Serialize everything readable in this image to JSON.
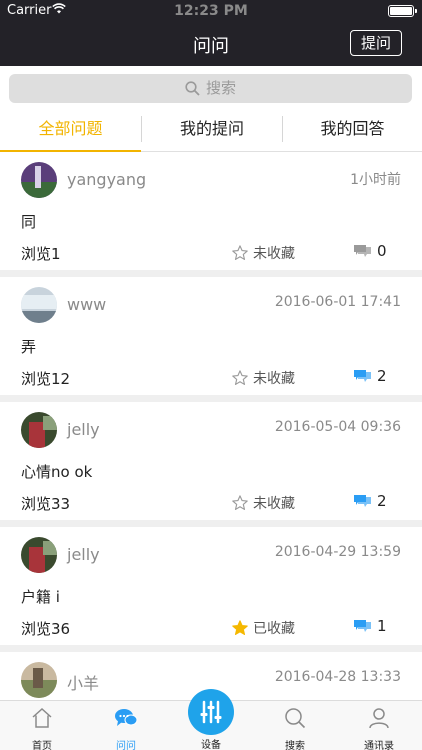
{
  "status_bar": {
    "carrier": "Carrier",
    "time": "12:23 PM"
  },
  "nav": {
    "title": "问问",
    "ask_button": "提问"
  },
  "search": {
    "placeholder": "搜索"
  },
  "tabs": [
    {
      "label": "全部问题",
      "active": true
    },
    {
      "label": "我的提问",
      "active": false
    },
    {
      "label": "我的回答",
      "active": false
    }
  ],
  "questions": [
    {
      "username": "yangyang",
      "time": "1小时前",
      "text": "同",
      "views": "浏览1",
      "fav_label": "未收藏",
      "favorited": false,
      "replies": "0",
      "reply_color": "#9a9a9a",
      "avatar": "avatar-purple-icon"
    },
    {
      "username": "www",
      "time": "2016-06-01 17:41",
      "text": "弄",
      "views": "浏览12",
      "fav_label": "未收藏",
      "favorited": false,
      "replies": "2",
      "reply_color": "#2a9df4",
      "avatar": "avatar-sky-icon"
    },
    {
      "username": "jelly",
      "time": "2016-05-04 09:36",
      "text": "心情no ok",
      "views": "浏览33",
      "fav_label": "未收藏",
      "favorited": false,
      "replies": "2",
      "reply_color": "#2a9df4",
      "avatar": "avatar-red-icon"
    },
    {
      "username": "jelly",
      "time": "2016-04-29 13:59",
      "text": "户籍 i",
      "views": "浏览36",
      "fav_label": "已收藏",
      "favorited": true,
      "replies": "1",
      "reply_color": "#2a9df4",
      "avatar": "avatar-red-icon"
    },
    {
      "username": "小羊",
      "time": "2016-04-28 13:33",
      "text": "",
      "views": "",
      "fav_label": "",
      "favorited": false,
      "replies": "",
      "reply_color": "#2a9df4",
      "avatar": "avatar-outdoor-icon"
    }
  ],
  "tabbar": {
    "home": "首页",
    "ask": "问问",
    "device": "设备",
    "search": "搜索",
    "contacts": "通讯录"
  },
  "colors": {
    "accent": "#f2b400",
    "blue": "#2a9df4",
    "nav_bg": "#232228"
  }
}
